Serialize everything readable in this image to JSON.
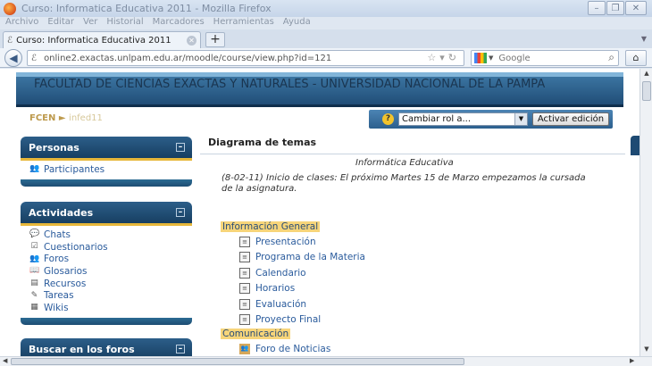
{
  "window": {
    "title": "Curso: Informatica Educativa 2011 - Mozilla Firefox",
    "min": "–",
    "max": "❐",
    "close": "✕"
  },
  "menu": [
    "Archivo",
    "Editar",
    "Ver",
    "Historial",
    "Marcadores",
    "Herramientas",
    "Ayuda"
  ],
  "tab": {
    "title": "Curso: Informatica Educativa 2011",
    "newtab": "+"
  },
  "nav": {
    "url": "online2.exactas.unlpam.edu.ar/moodle/course/view.php?id=121",
    "search_placeholder": "Google"
  },
  "page": {
    "header_title": "FACULTAD DE CIENCIAS EXACTAS Y NATURALES - UNIVERSIDAD NACIONAL DE LA PAMPA",
    "breadcrumb": {
      "root": "FCEN",
      "sep": "►",
      "current": "infed11"
    },
    "role_select": "Cambiar rol a...",
    "edit_button": "Activar edición",
    "blocks": {
      "personas": {
        "title": "Personas",
        "items": [
          "Participantes"
        ]
      },
      "actividades": {
        "title": "Actividades",
        "items": [
          "Chats",
          "Cuestionarios",
          "Foros",
          "Glosarios",
          "Recursos",
          "Tareas",
          "Wikis"
        ]
      },
      "buscar": {
        "title": "Buscar en los foros"
      }
    },
    "main": {
      "heading": "Diagrama de temas",
      "course_name": "Informática Educativa",
      "summary": "(8-02-11) Inicio de clases: El próximo Martes 15 de Marzo empezamos la cursada de la asignatura.",
      "sections": [
        {
          "title": "Información General",
          "items": [
            "Presentación",
            "Programa de la Materia",
            "Calendario",
            "Horarios",
            "Evaluación",
            "Proyecto Final"
          ]
        },
        {
          "title": "Comunicación",
          "items": [
            "Foro de Noticias"
          ]
        }
      ]
    }
  }
}
